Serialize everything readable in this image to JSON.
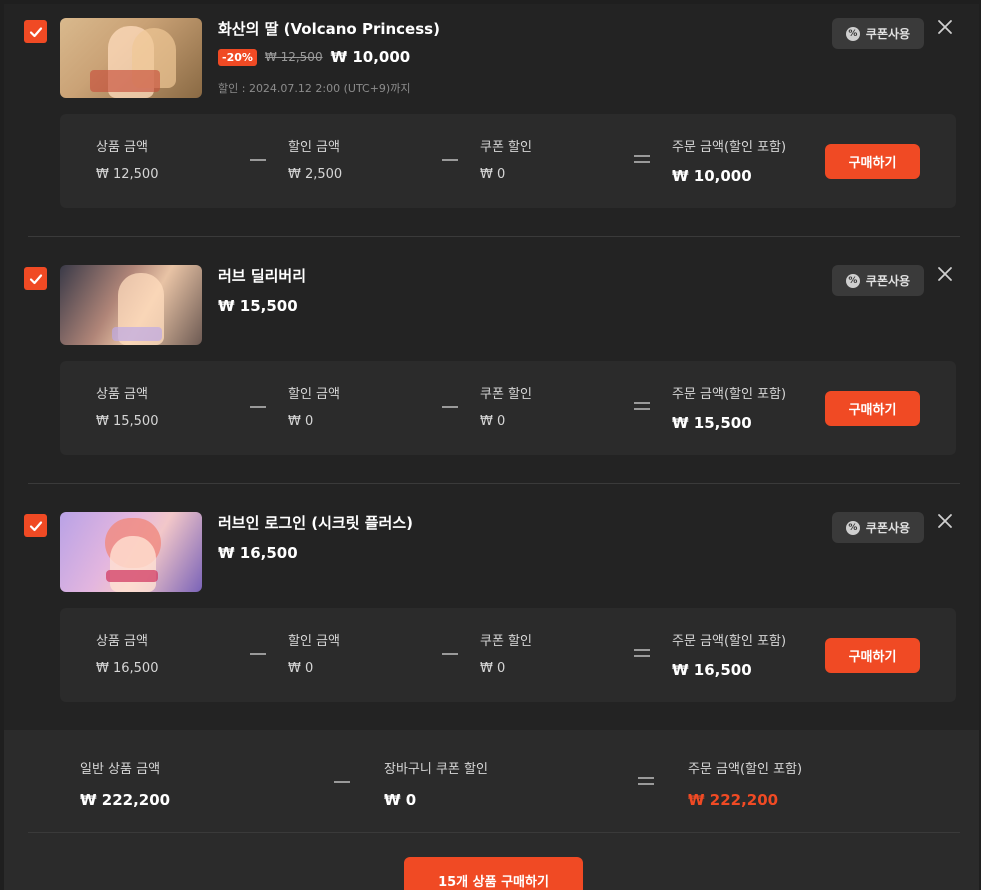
{
  "cart": {
    "items": [
      {
        "title": "화산의 딸 (Volcano Princess)",
        "discount_badge": "-20%",
        "old_price": "₩ 12,500",
        "price": "₩ 10,000",
        "sale_end": "할인 : 2024.07.12 2:00 (UTC+9)까지",
        "coupon_label": "쿠폰사용",
        "summary": {
          "product_label": "상품 금액",
          "product_value": "₩ 12,500",
          "discount_label": "할인 금액",
          "discount_value": "₩ 2,500",
          "coupon_label": "쿠폰 할인",
          "coupon_value": "₩ 0",
          "order_label": "주문 금액(할인 포함)",
          "order_value": "₩ 10,000",
          "buy_label": "구매하기"
        }
      },
      {
        "title": "러브 딜리버리",
        "price": "₩ 15,500",
        "coupon_label": "쿠폰사용",
        "summary": {
          "product_label": "상품 금액",
          "product_value": "₩ 15,500",
          "discount_label": "할인 금액",
          "discount_value": "₩ 0",
          "coupon_label": "쿠폰 할인",
          "coupon_value": "₩ 0",
          "order_label": "주문 금액(할인 포함)",
          "order_value": "₩ 15,500",
          "buy_label": "구매하기"
        }
      },
      {
        "title": "러브인 로그인 (시크릿 플러스)",
        "price": "₩ 16,500",
        "coupon_label": "쿠폰사용",
        "summary": {
          "product_label": "상품 금액",
          "product_value": "₩ 16,500",
          "discount_label": "할인 금액",
          "discount_value": "₩ 0",
          "coupon_label": "쿠폰 할인",
          "coupon_value": "₩ 0",
          "order_label": "주문 금액(할인 포함)",
          "order_value": "₩ 16,500",
          "buy_label": "구매하기"
        }
      }
    ],
    "total": {
      "general_label": "일반 상품 금액",
      "general_value": "₩ 222,200",
      "cart_coupon_label": "장바구니 쿠폰 할인",
      "cart_coupon_value": "₩ 0",
      "order_label": "주문 금액(할인 포함)",
      "order_value": "₩ 222,200",
      "checkout_label": "15개 상품 구매하기"
    },
    "colors": {
      "accent": "#f04a24",
      "background": "#232323",
      "panel": "#2b2b2b"
    },
    "icons": [
      "checkbox-checked-icon",
      "coupon-icon",
      "close-icon"
    ]
  }
}
